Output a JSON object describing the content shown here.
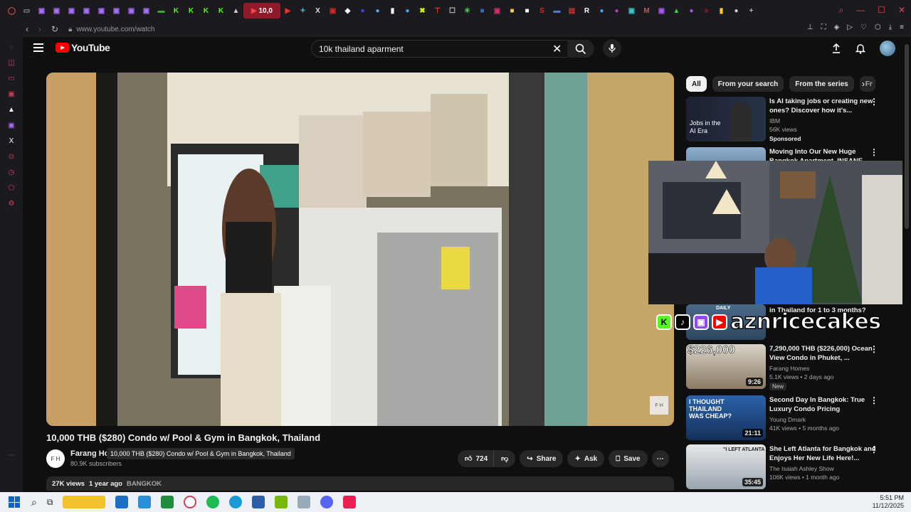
{
  "browser": {
    "active_tab_label": "10,0",
    "url": "www.youtube.com/watch"
  },
  "header": {
    "logo_text": "YouTube",
    "search_value": "10k thailand aparment"
  },
  "video": {
    "title": "10,000 THB ($280) Condo w/ Pool & Gym in Bangkok, Thailand",
    "channel_initials": "F H",
    "channel_name": "Farang Hor",
    "subscribers": "80.9K subscribers",
    "tooltip": "10,000 THB ($280) Condo w/ Pool & Gym in Bangkok, Thailand",
    "watermark": "F H",
    "likes": "724",
    "share_label": "Share",
    "ask_label": "Ask",
    "save_label": "Save",
    "views": "27K views",
    "age": "1 year ago",
    "tag": "BANGKOK"
  },
  "chips": [
    {
      "label": "All"
    },
    {
      "label": "From your search"
    },
    {
      "label": "From the series"
    },
    {
      "label": "Fr"
    }
  ],
  "recommendations": [
    {
      "title": "Is AI taking jobs or creating new ones? Discover how it's...",
      "channel": "IBM",
      "meta": "56K views",
      "badge": "Sponsored",
      "thumb_text": "Jobs in the AI Era",
      "duration": ""
    },
    {
      "title": "Moving Into Our New Huge Bangkok Apartment, INSANE",
      "channel": "",
      "meta": "",
      "badge": "",
      "thumb_text": "",
      "duration": ""
    },
    {
      "title": "in Thailand for 1 to 3 months?",
      "channel": "",
      "meta": "",
      "badge": "",
      "thumb_text": "DAILY",
      "duration": ""
    },
    {
      "title": "7,290,000 THB ($226,000) Ocean View Condo in Phuket, ...",
      "channel": "Farang Homes",
      "meta": "5.1K views • 2 days ago",
      "badge": "New",
      "thumb_text": "$226,000",
      "duration": "9:26"
    },
    {
      "title": "Second Day In Bangkok: True Luxury Condo Pricing",
      "channel": "Young Dmark",
      "meta": "41K views • 5 months ago",
      "badge": "",
      "thumb_text": "I THOUGHT THAILAND WAS CHEAP?",
      "duration": "21:11"
    },
    {
      "title": "She Left Atlanta for Bangkok and Enjoys Her New Life Here!...",
      "channel": "The Isaiah Ashley Show",
      "meta": "106K views • 1 month ago",
      "badge": "",
      "thumb_text": "\"I LEFT ATLANTA",
      "duration": "35:45"
    }
  ],
  "stream_overlay": {
    "name": "aznricecakes"
  },
  "taskbar": {
    "time": "5:51 PM",
    "date": "11/12/2025"
  },
  "colors": {
    "youtube_red": "#ff0000",
    "opera_accent": "#d23d55"
  }
}
